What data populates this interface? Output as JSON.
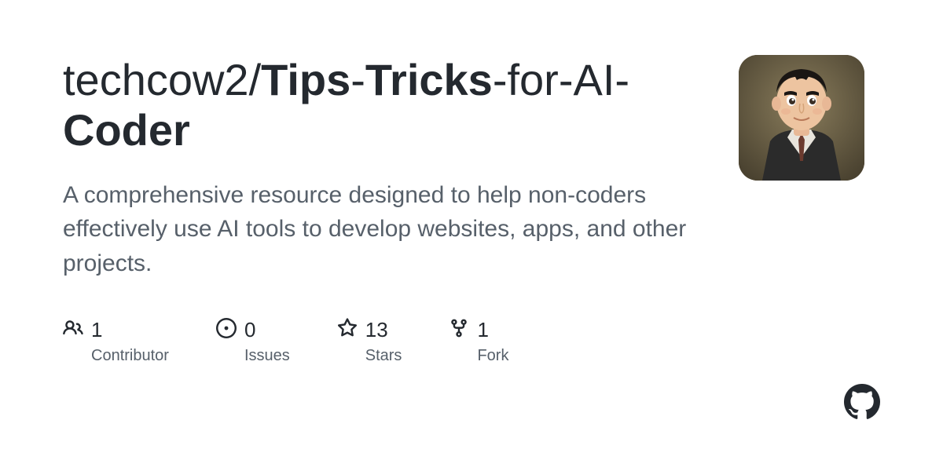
{
  "repo": {
    "owner": "techcow2",
    "separator": "/",
    "name_parts": {
      "p1": "Tips",
      "p2": "-",
      "p3": "Tricks",
      "p4": "-for-AI-",
      "p5": "Coder"
    }
  },
  "description": "A comprehensive resource designed to help non-coders effectively use AI tools to develop websites, apps, and other projects.",
  "stats": {
    "contributors": {
      "count": "1",
      "label": "Contributor"
    },
    "issues": {
      "count": "0",
      "label": "Issues"
    },
    "stars": {
      "count": "13",
      "label": "Stars"
    },
    "forks": {
      "count": "1",
      "label": "Fork"
    }
  }
}
